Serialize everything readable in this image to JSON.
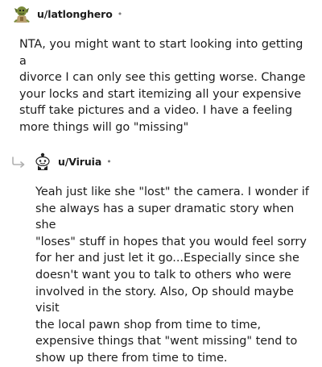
{
  "comments": [
    {
      "username": "u/latlonghero",
      "separator": "•",
      "avatar": "goblin-avatar-icon",
      "text": "NTA, you might want to start looking into getting a\ndivorce I can only see this getting worse. Change\nyour locks and start itemizing all your expensive\nstuff take pictures and a video. I have a feeling\nmore things will go \"missing\""
    },
    {
      "username": "u/Viruia",
      "separator": "•",
      "avatar": "snoo-avatar-icon",
      "reply_icon": "reply-arrow-icon",
      "text": "Yeah just like she \"lost\" the camera. I wonder if\nshe always has a super dramatic story when she\n\"loses\" stuff in hopes that you would feel sorry\nfor her and just let it go...Especially since she\ndoesn't want you to talk to others who were\ninvolved in the story. Also, Op should maybe visit\nthe local pawn shop from time to time,\nexpensive things that \"went missing\" tend to\nshow up there from time to time."
    }
  ],
  "colors": {
    "text": "#1c1c1c",
    "meta": "#7c7c7c",
    "reply_arrow": "#b0b0b0"
  }
}
